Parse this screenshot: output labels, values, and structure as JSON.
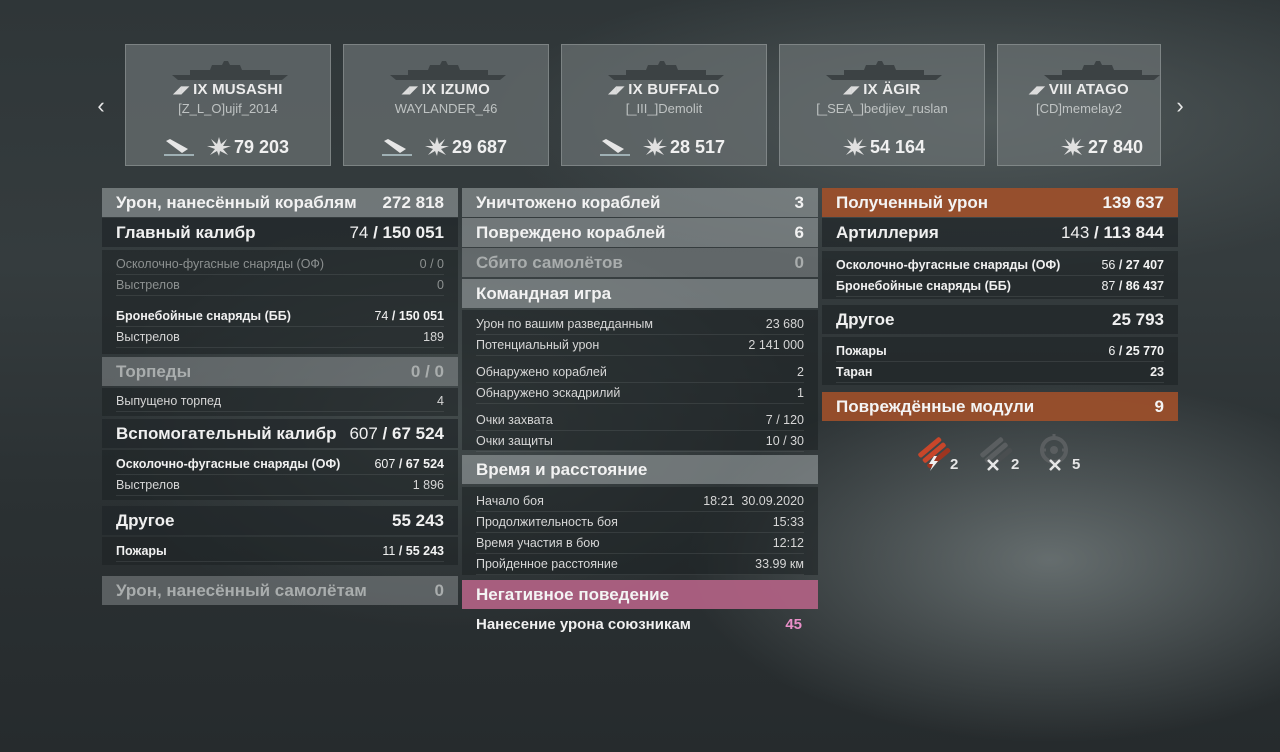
{
  "nav": {
    "prev_glyph": "‹",
    "next_glyph": "›"
  },
  "ships": [
    {
      "nation": "◢◤",
      "name": "IX MUSASHI",
      "player": "[Z_L_O]ujif_2014",
      "damage": "79 203",
      "sunk": true
    },
    {
      "nation": "◢◤",
      "name": "IX IZUMO",
      "player": "WAYLANDER_46",
      "damage": "29 687",
      "sunk": true
    },
    {
      "nation": "◢◤",
      "name": "IX BUFFALO",
      "player": "[_III_]Demolit",
      "damage": "28 517",
      "sunk": true
    },
    {
      "nation": "◢◤",
      "name": "IX ÄGIR",
      "player": "[_SEA_]bedjiev_ruslan",
      "damage": "54 164",
      "sunk": false
    },
    {
      "nation": "◢◤",
      "name": "VIII ATAGO",
      "player": "[CD]memelay2",
      "damage": "27 840",
      "sunk": false
    }
  ],
  "left": {
    "ship_damage": {
      "label": "Урон, нанесённый кораблям",
      "value": "272 818"
    },
    "main_battery": {
      "label": "Главный калибр",
      "hits": "74",
      "value": "150 051"
    },
    "he": {
      "label": "Осколочно-фугасные снаряды (ОФ)",
      "value": "0 / 0"
    },
    "he_shots": {
      "label": "Выстрелов",
      "value": "0"
    },
    "ap": {
      "label": "Бронебойные снаряды (ББ)",
      "hits": "74",
      "value": "150 051"
    },
    "ap_shots": {
      "label": "Выстрелов",
      "value": "189"
    },
    "torpedoes": {
      "label": "Торпеды",
      "value": "0 / 0"
    },
    "torps_fired": {
      "label": "Выпущено торпед",
      "value": "4"
    },
    "secondary": {
      "label": "Вспомогательный калибр",
      "hits": "607",
      "value": "67 524"
    },
    "sec_he": {
      "label": "Осколочно-фугасные снаряды (ОФ)",
      "hits": "607",
      "value": "67 524"
    },
    "sec_shots": {
      "label": "Выстрелов",
      "value": "1 896"
    },
    "other": {
      "label": "Другое",
      "value": "55 243"
    },
    "fires": {
      "label": "Пожары",
      "hits": "11",
      "value": "55 243"
    },
    "plane_damage": {
      "label": "Урон, нанесённый самолётам",
      "value": "0"
    }
  },
  "mid": {
    "destroyed": {
      "label": "Уничтожено кораблей",
      "value": "3"
    },
    "damaged": {
      "label": "Повреждено кораблей",
      "value": "6"
    },
    "planes": {
      "label": "Сбито самолётов",
      "value": "0"
    },
    "team": {
      "label": "Командная игра"
    },
    "spot_dmg": {
      "label": "Урон по вашим разведданным",
      "value": "23 680"
    },
    "potential": {
      "label": "Потенциальный урон",
      "value": "2 141 000"
    },
    "ships_spotted": {
      "label": "Обнаружено кораблей",
      "value": "2"
    },
    "sq_spotted": {
      "label": "Обнаружено эскадрилий",
      "value": "1"
    },
    "capture": {
      "label": "Очки захвата",
      "value": "7 / 120"
    },
    "defense": {
      "label": "Очки защиты",
      "value": "10 / 30"
    },
    "time": {
      "label": "Время и расстояние"
    },
    "start": {
      "label": "Начало боя",
      "value": "18:21  30.09.2020"
    },
    "duration": {
      "label": "Продолжительность боя",
      "value": "15:33"
    },
    "participation": {
      "label": "Время участия в бою",
      "value": "12:12"
    },
    "distance": {
      "label": "Пройденное расстояние",
      "value": "33.99 км"
    },
    "negative": {
      "label": "Негативное поведение"
    },
    "team_damage": {
      "label": "Нанесение урона союзникам",
      "value": "45",
      "color": "#e98fc8"
    }
  },
  "right": {
    "received": {
      "label": "Полученный урон",
      "value": "139 637"
    },
    "artillery": {
      "label": "Артиллерия",
      "hits": "143",
      "value": "113 844"
    },
    "he": {
      "label": "Осколочно-фугасные снаряды (ОФ)",
      "hits": "56",
      "value": "27 407"
    },
    "ap": {
      "label": "Бронебойные снаряды (ББ)",
      "hits": "87",
      "value": "86 437"
    },
    "other": {
      "label": "Другое",
      "value": "25 793"
    },
    "fires": {
      "label": "Пожары",
      "hits": "6",
      "value": "25 770"
    },
    "ram": {
      "label": "Таран",
      "value": "23"
    },
    "modules": {
      "label": "Повреждённые модули",
      "value": "9"
    },
    "module_icons": [
      {
        "icon": "damaged-guns-icon",
        "count": "2",
        "color": "#c8462a"
      },
      {
        "icon": "destroyed-guns-icon",
        "count": "2",
        "color": "#5a5e60"
      },
      {
        "icon": "destroyed-aa-icon",
        "count": "5",
        "color": "#5a5e60"
      }
    ]
  }
}
